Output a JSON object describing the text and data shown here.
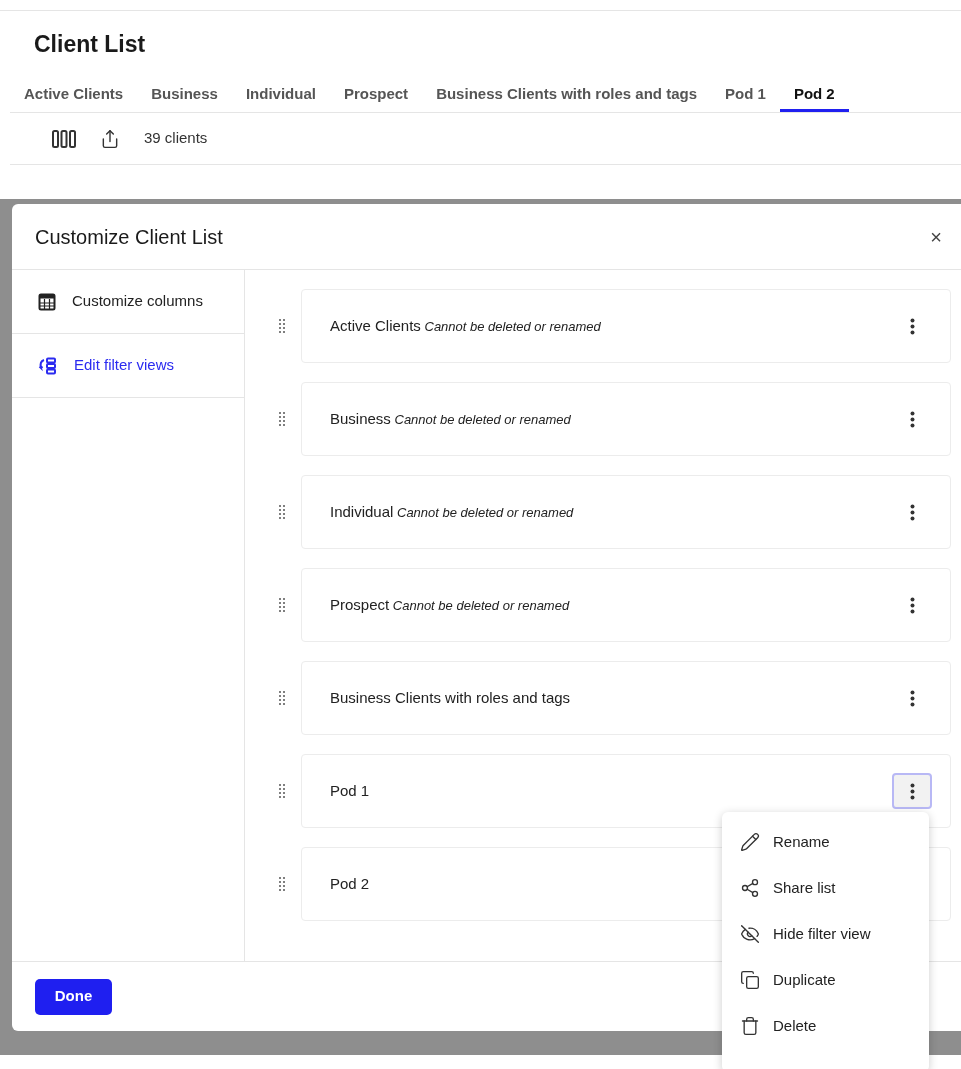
{
  "page": {
    "title": "Client List"
  },
  "tabs": [
    {
      "label": "Active Clients",
      "selected": false
    },
    {
      "label": "Business",
      "selected": false
    },
    {
      "label": "Individual",
      "selected": false
    },
    {
      "label": "Prospect",
      "selected": false
    },
    {
      "label": "Business Clients with roles and tags",
      "selected": false
    },
    {
      "label": "Pod 1",
      "selected": false
    },
    {
      "label": "Pod 2",
      "selected": true
    }
  ],
  "toolbar": {
    "count": "39 clients"
  },
  "dialog": {
    "title": "Customize Client List",
    "close": "×",
    "sidebar": [
      {
        "kind": "table",
        "label": "Customize columns",
        "selected": false
      },
      {
        "kind": "filter",
        "label": "Edit filter views",
        "selected": true
      }
    ],
    "views": [
      {
        "name": "Active Clients",
        "note": "Cannot be deleted or renamed",
        "menu_open": false
      },
      {
        "name": "Business",
        "note": "Cannot be deleted or renamed",
        "menu_open": false
      },
      {
        "name": "Individual",
        "note": "Cannot be deleted or renamed",
        "menu_open": false
      },
      {
        "name": "Prospect",
        "note": "Cannot be deleted or renamed",
        "menu_open": false
      },
      {
        "name": "Business Clients with roles and tags",
        "menu_open": false
      },
      {
        "name": "Pod 1",
        "menu_open": true
      },
      {
        "name": "Pod 2"
      }
    ],
    "done": "Done"
  },
  "menu": [
    {
      "kind": "rename",
      "label": "Rename"
    },
    {
      "kind": "share",
      "label": "Share list"
    },
    {
      "kind": "hide",
      "label": "Hide filter view"
    },
    {
      "kind": "duplicate",
      "label": "Duplicate"
    },
    {
      "kind": "delete",
      "label": "Delete"
    }
  ]
}
